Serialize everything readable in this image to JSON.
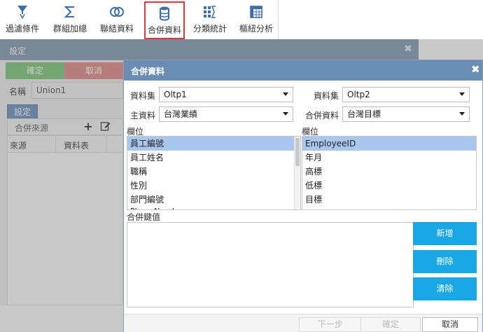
{
  "toolbar": {
    "tools": [
      {
        "label": "過濾條件",
        "icon": "filter-icon"
      },
      {
        "label": "群組加總",
        "icon": "sigma-icon"
      },
      {
        "label": "聯結資料",
        "icon": "join-icon"
      },
      {
        "label": "合併資料",
        "icon": "merge-database-icon",
        "active": true
      },
      {
        "label": "分類統計",
        "icon": "category-stats-icon"
      },
      {
        "label": "樞紐分析",
        "icon": "pivot-icon"
      }
    ],
    "accent_color": "#e0353d"
  },
  "settings_dialog": {
    "title": "設定",
    "ok_label": "確定",
    "cancel_label": "取消",
    "name_label": "名稱",
    "name_value": "Union1",
    "tab_label": "設定",
    "merge_source_label": "合併來源",
    "table_headers": [
      "來源",
      "資料表"
    ]
  },
  "merge_dialog": {
    "title": "合併資料",
    "left": {
      "dataset_label": "資料集",
      "dataset_value": "Oltp1",
      "main_label": "主資料",
      "main_value": "台灣業績",
      "fields_label": "欄位",
      "fields": [
        "員工編號",
        "員工姓名",
        "職稱",
        "性別",
        "部門編號",
        "PhoneNumber"
      ],
      "selected_index": 0
    },
    "right": {
      "dataset_label": "資料集",
      "dataset_value": "Oltp2",
      "merge_label": "合併資料",
      "merge_value": "台灣目標",
      "fields_label": "欄位",
      "fields": [
        "EmployeeID",
        "年月",
        "高標",
        "低標",
        "目標"
      ],
      "selected_index": 0
    },
    "key_label": "合併鍵值",
    "buttons": {
      "add": "新增",
      "delete": "刪除",
      "clear": "清除"
    },
    "footer": {
      "prev": "下一步",
      "confirm": "確定",
      "cancel": "取消"
    },
    "colors": {
      "title_bar": "#6a8db4",
      "action_button": "#19a7e6",
      "selection": "#a9c6ee"
    }
  }
}
